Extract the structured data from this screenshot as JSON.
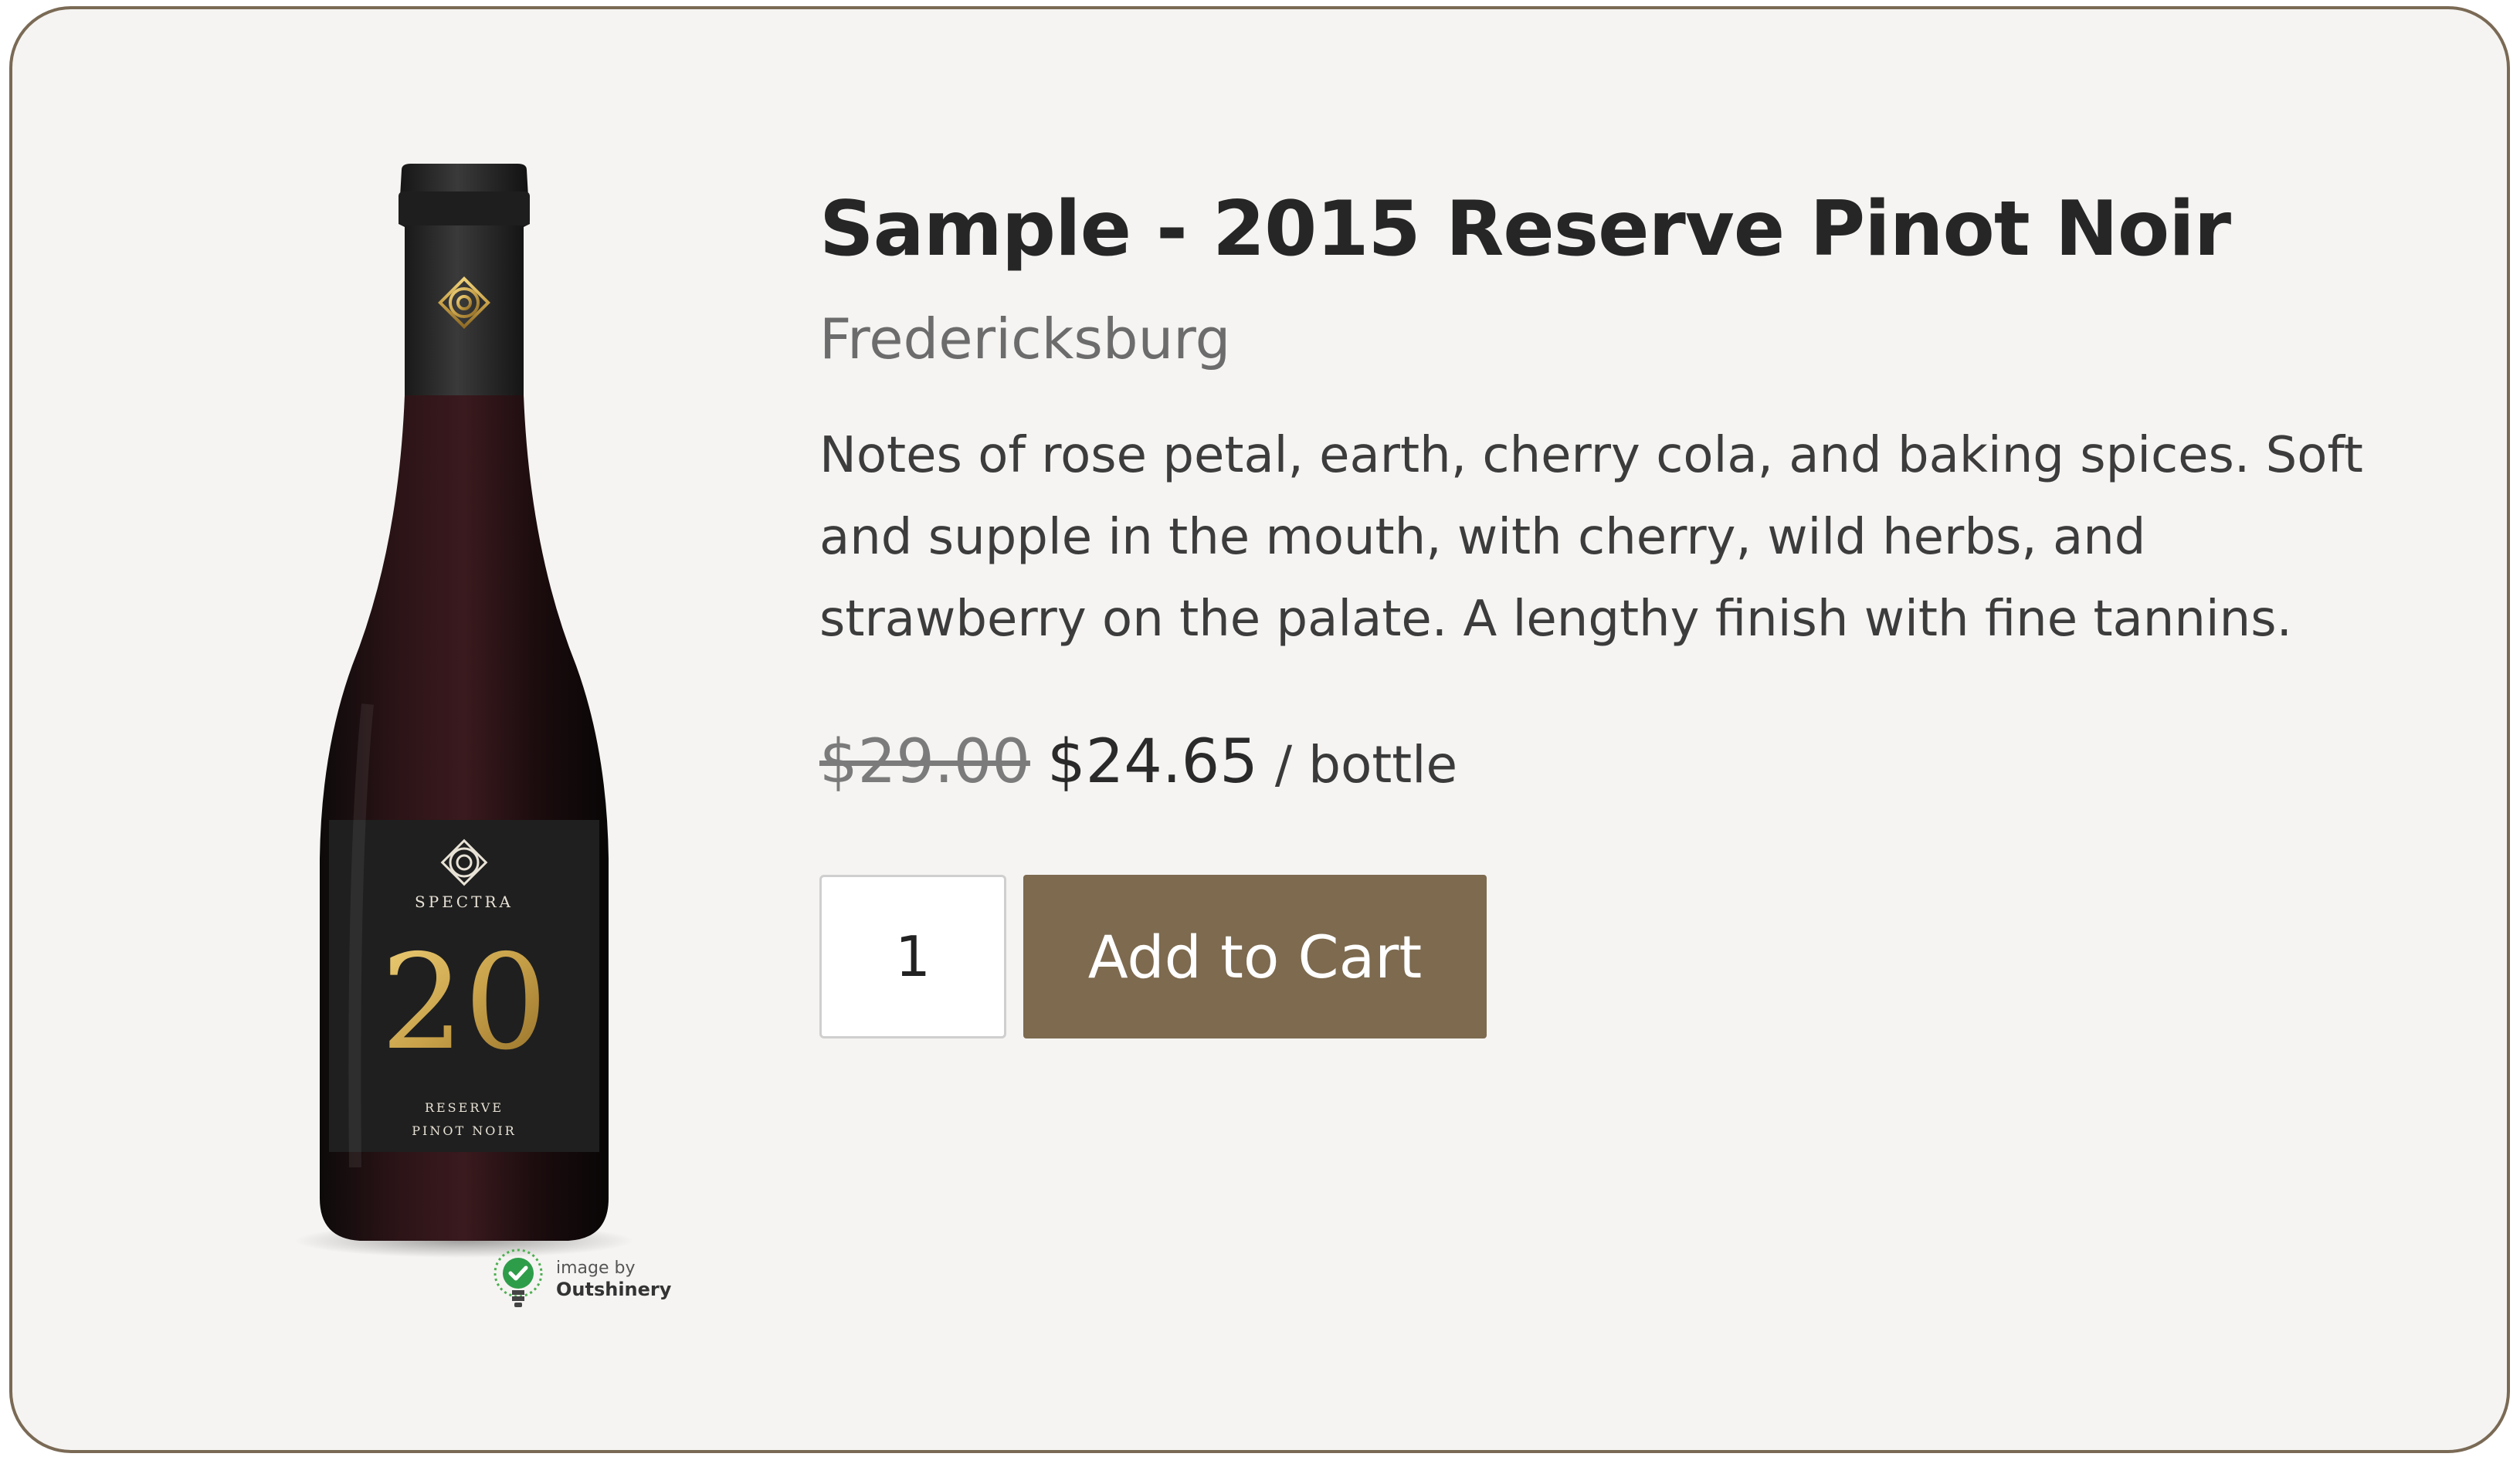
{
  "product": {
    "title": "Sample - 2015 Reserve Pinot Noir",
    "location": "Fredericksburg",
    "description": "Notes of rose petal, earth, cherry cola, and baking spices. Soft and supple in the mouth, with cherry, wild herbs, and strawberry on the palate. A lengthy finish with fine tannins.",
    "price_original": "$29.00",
    "price_sale": "$24.65",
    "price_unit": "/ bottle"
  },
  "cart": {
    "quantity": "1",
    "add_label": "Add to Cart"
  },
  "image": {
    "label_brand": "SPECTRA",
    "label_number": "20",
    "label_line1": "RESERVE",
    "label_line2": "PINOT NOIR",
    "credit_small": "image by",
    "credit_brand": "Outshinery"
  },
  "colors": {
    "accent": "#7d6a4f",
    "border": "#7a6a55",
    "background": "#f5f4f2",
    "gold": "#c9a24a"
  }
}
